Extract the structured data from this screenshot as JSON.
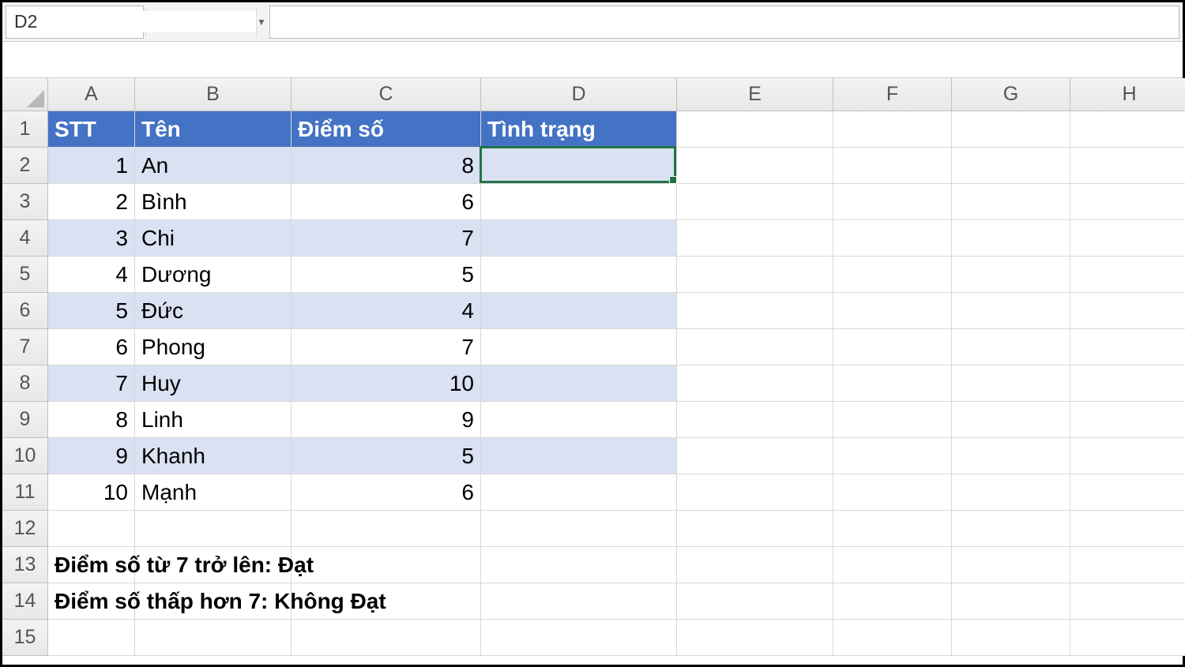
{
  "namebox": "D2",
  "formula": "",
  "columns": [
    "A",
    "B",
    "C",
    "D",
    "E",
    "F",
    "G",
    "H"
  ],
  "rows_shown": 15,
  "table": {
    "headers": {
      "stt": "STT",
      "ten": "Tên",
      "diem": "Điểm số",
      "tinhtrang": "Tình trạng"
    },
    "rows": [
      {
        "stt": "1",
        "ten": "An",
        "diem": "8",
        "tinhtrang": ""
      },
      {
        "stt": "2",
        "ten": "Bình",
        "diem": "6",
        "tinhtrang": ""
      },
      {
        "stt": "3",
        "ten": "Chi",
        "diem": "7",
        "tinhtrang": ""
      },
      {
        "stt": "4",
        "ten": "Dương",
        "diem": "5",
        "tinhtrang": ""
      },
      {
        "stt": "5",
        "ten": "Đức",
        "diem": "4",
        "tinhtrang": ""
      },
      {
        "stt": "6",
        "ten": "Phong",
        "diem": "7",
        "tinhtrang": ""
      },
      {
        "stt": "7",
        "ten": "Huy",
        "diem": "10",
        "tinhtrang": ""
      },
      {
        "stt": "8",
        "ten": "Linh",
        "diem": "9",
        "tinhtrang": ""
      },
      {
        "stt": "9",
        "ten": "Khanh",
        "diem": "5",
        "tinhtrang": ""
      },
      {
        "stt": "10",
        "ten": "Mạnh",
        "diem": "6",
        "tinhtrang": ""
      }
    ]
  },
  "notes": {
    "line1": "Điểm số từ 7 trở lên: Đạt",
    "line2": "Điểm số thấp hơn 7: Không Đạt"
  },
  "active_cell": "D2",
  "colors": {
    "header_bg": "#4472C4",
    "band_bg": "#D9E1F2",
    "selection": "#217346"
  }
}
